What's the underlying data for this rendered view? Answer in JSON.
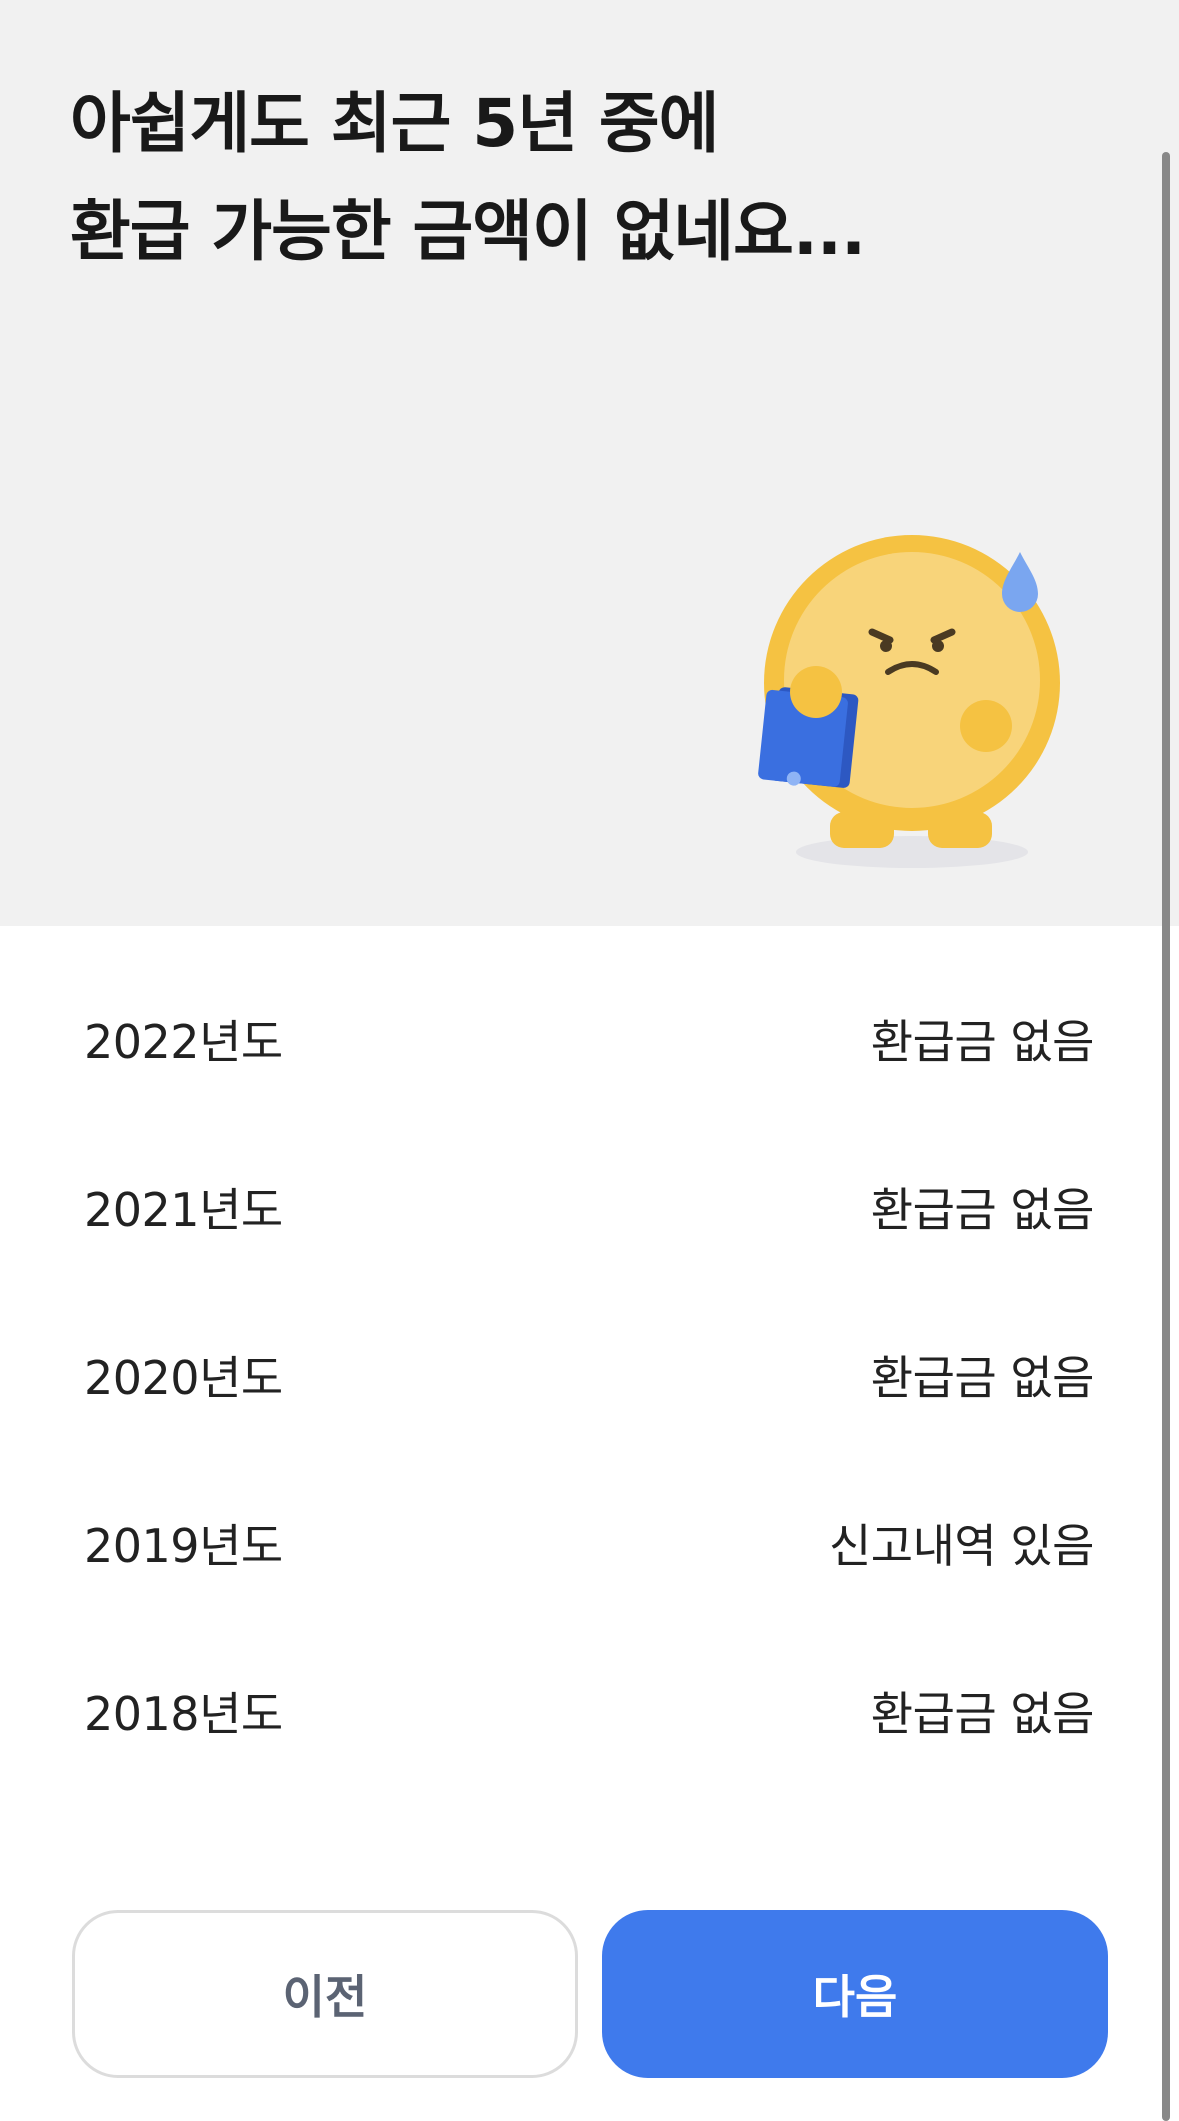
{
  "headline": {
    "line1": "아쉽게도 최근 5년 중에",
    "line2": "환급 가능한 금액이 없네요..."
  },
  "illustration": {
    "icon": "sad-coin-character-icon",
    "colors": {
      "coin": "#f5c242",
      "coin_inner": "#f8d47a",
      "book": "#3a6fe0",
      "sweat": "#7aa6f0"
    }
  },
  "years": [
    {
      "year": "2022년도",
      "status": "환급금 없음"
    },
    {
      "year": "2021년도",
      "status": "환급금 없음"
    },
    {
      "year": "2020년도",
      "status": "환급금 없음"
    },
    {
      "year": "2019년도",
      "status": "신고내역 있음"
    },
    {
      "year": "2018년도",
      "status": "환급금 없음"
    }
  ],
  "buttons": {
    "prev": "이전",
    "next": "다음"
  },
  "colors": {
    "accent": "#3f7aec",
    "hero_bg": "#f1f1f1"
  }
}
